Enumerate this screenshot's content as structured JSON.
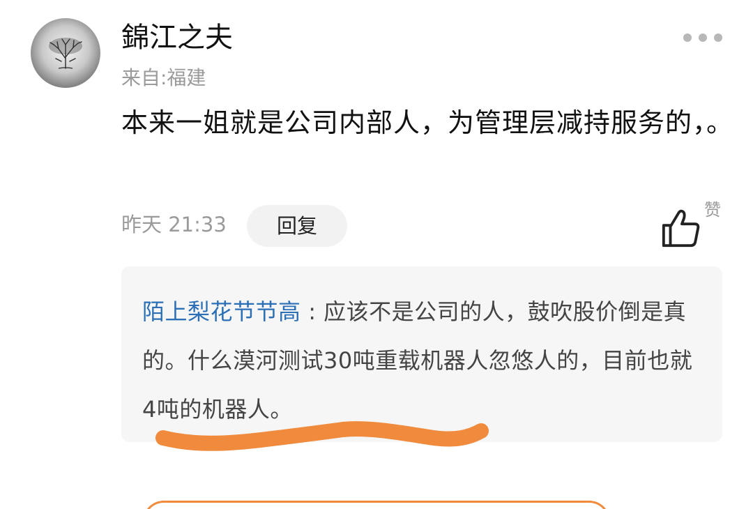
{
  "comment": {
    "username": "錦江之夫",
    "location": "来自:福建",
    "content": "本来一姐就是公司内部人，为管理层减持服务的，。",
    "time": "昨天 21:33",
    "reply_label": "回复",
    "like_label": "赞"
  },
  "reply": {
    "username": "陌上梨花节节高",
    "separator": " : ",
    "text": "应该不是公司的人，鼓吹股价倒是真的。什么漠河测试30吨重载机器人忽悠人的，目前也就4吨的机器人。"
  },
  "colors": {
    "reply_username": "#2b6fb6",
    "annotation": "#f08a3c",
    "secondary_text": "#9a9a9a"
  },
  "icons": {
    "avatar": "tree-avatar",
    "more": "more-dots-icon",
    "like": "thumbs-up-icon"
  }
}
